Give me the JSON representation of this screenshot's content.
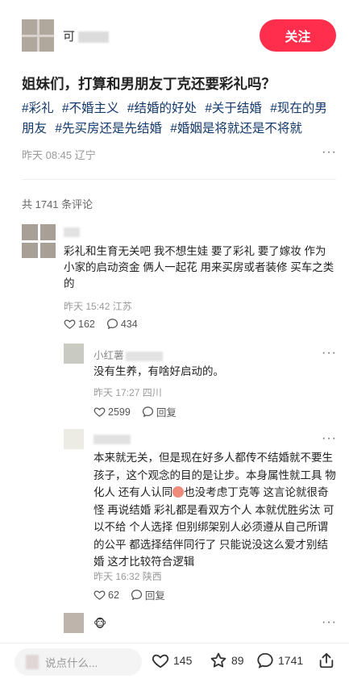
{
  "author": {
    "name": "可",
    "follow_label": "关注"
  },
  "post": {
    "title": "姐妹们，打算和男朋友丁克还要彩礼吗？",
    "tags": [
      "#彩礼",
      "#不婚主义",
      "#结婚的好处",
      "#关于结婚",
      "#现在的男朋友",
      "#先买房还是先结婚",
      "#婚姻是将就还是不将就"
    ],
    "meta": "昨天 08:45 辽宁"
  },
  "comments_header": "共 1741 条评论",
  "comments": [
    {
      "text": "彩礼和生育无关吧 我不想生娃 要了彩礼 要了嫁妆 作为小家的启动资金 俩人一起花 用来买房或者装修 买车之类的",
      "meta": "昨天 15:42 江苏",
      "likes": "162",
      "replies": "434"
    },
    {
      "name": "小红薯",
      "text": "没有生养，有啥好启动的。",
      "meta": "昨天 17:27 四川",
      "likes": "2599",
      "reply_label": "回复"
    },
    {
      "text_a": "本来就无关，但是现在好多人都传不结婚就不要生孩子，这个观念的目的是让步。本身属性就工具 物化人 还有人认同",
      "text_b": "也没考虑丁克等 这言论就很奇怪 再说结婚 彩礼都是看双方个人 本就优胜劣汰 可以不给 个人选择 但别绑架别人必须遵从自己所谓的公平 都选择结伴同行了 只能说没这么爱才别结婚 这才比较符合逻辑",
      "meta": "昨天 16:32 陕西",
      "likes": "62",
      "reply_label": "回复"
    }
  ],
  "bottom": {
    "placeholder": "说点什么...",
    "like_count": "145",
    "star_count": "89",
    "comment_count": "1741"
  }
}
